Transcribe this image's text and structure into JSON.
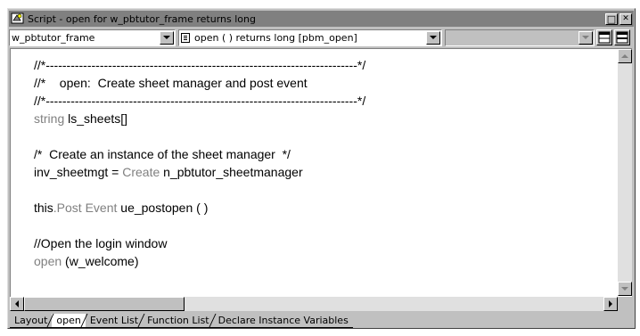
{
  "window": {
    "title": "Script - open for w_pbtutor_frame returns long",
    "minimize_glyph": "□",
    "close_glyph": "✕"
  },
  "toolbar": {
    "object_combo_value": "w_pbtutor_frame",
    "event_combo_value": "open ( )  returns long [pbm_open]",
    "ancestor_combo_value": ""
  },
  "code_lines": [
    {
      "parts": [
        {
          "t": "//*---------------------------------------------------------------------------*/",
          "k": false
        }
      ]
    },
    {
      "parts": [
        {
          "t": "//*    open:  Create sheet manager and post event",
          "k": false
        }
      ]
    },
    {
      "parts": [
        {
          "t": "//*---------------------------------------------------------------------------*/",
          "k": false
        }
      ]
    },
    {
      "parts": [
        {
          "t": "string ",
          "k": true
        },
        {
          "t": "ls_sheets[]",
          "k": false
        }
      ]
    },
    {
      "parts": [
        {
          "t": "",
          "k": false
        }
      ]
    },
    {
      "parts": [
        {
          "t": "/*  Create an instance of the sheet manager  */",
          "k": false
        }
      ]
    },
    {
      "parts": [
        {
          "t": "inv_sheetmgt = ",
          "k": false
        },
        {
          "t": "Create ",
          "k": true
        },
        {
          "t": "n_pbtutor_sheetmanager",
          "k": false
        }
      ]
    },
    {
      "parts": [
        {
          "t": "",
          "k": false
        }
      ]
    },
    {
      "parts": [
        {
          "t": "this",
          "k": false
        },
        {
          "t": ".Post Event ",
          "k": true
        },
        {
          "t": "ue_postopen ( )",
          "k": false
        }
      ]
    },
    {
      "parts": [
        {
          "t": "",
          "k": false
        }
      ]
    },
    {
      "parts": [
        {
          "t": "//Open the login window",
          "k": false
        }
      ]
    },
    {
      "parts": [
        {
          "t": "open ",
          "k": true
        },
        {
          "t": "(w_welcome)",
          "k": false
        }
      ]
    }
  ],
  "tabs": [
    {
      "label": "Layout",
      "active": false
    },
    {
      "label": "open",
      "active": true
    },
    {
      "label": "Event List",
      "active": false
    },
    {
      "label": "Function List",
      "active": false
    },
    {
      "label": "Declare Instance Variables",
      "active": false
    }
  ],
  "icons": {
    "app": "script-icon",
    "event": "event-icon",
    "view_top": "split-view-icon",
    "view_bottom": "split-horizontal-icon"
  },
  "colors": {
    "titlebar": "#808080",
    "keyword": "#808080",
    "chrome": "#c0c0c0"
  }
}
